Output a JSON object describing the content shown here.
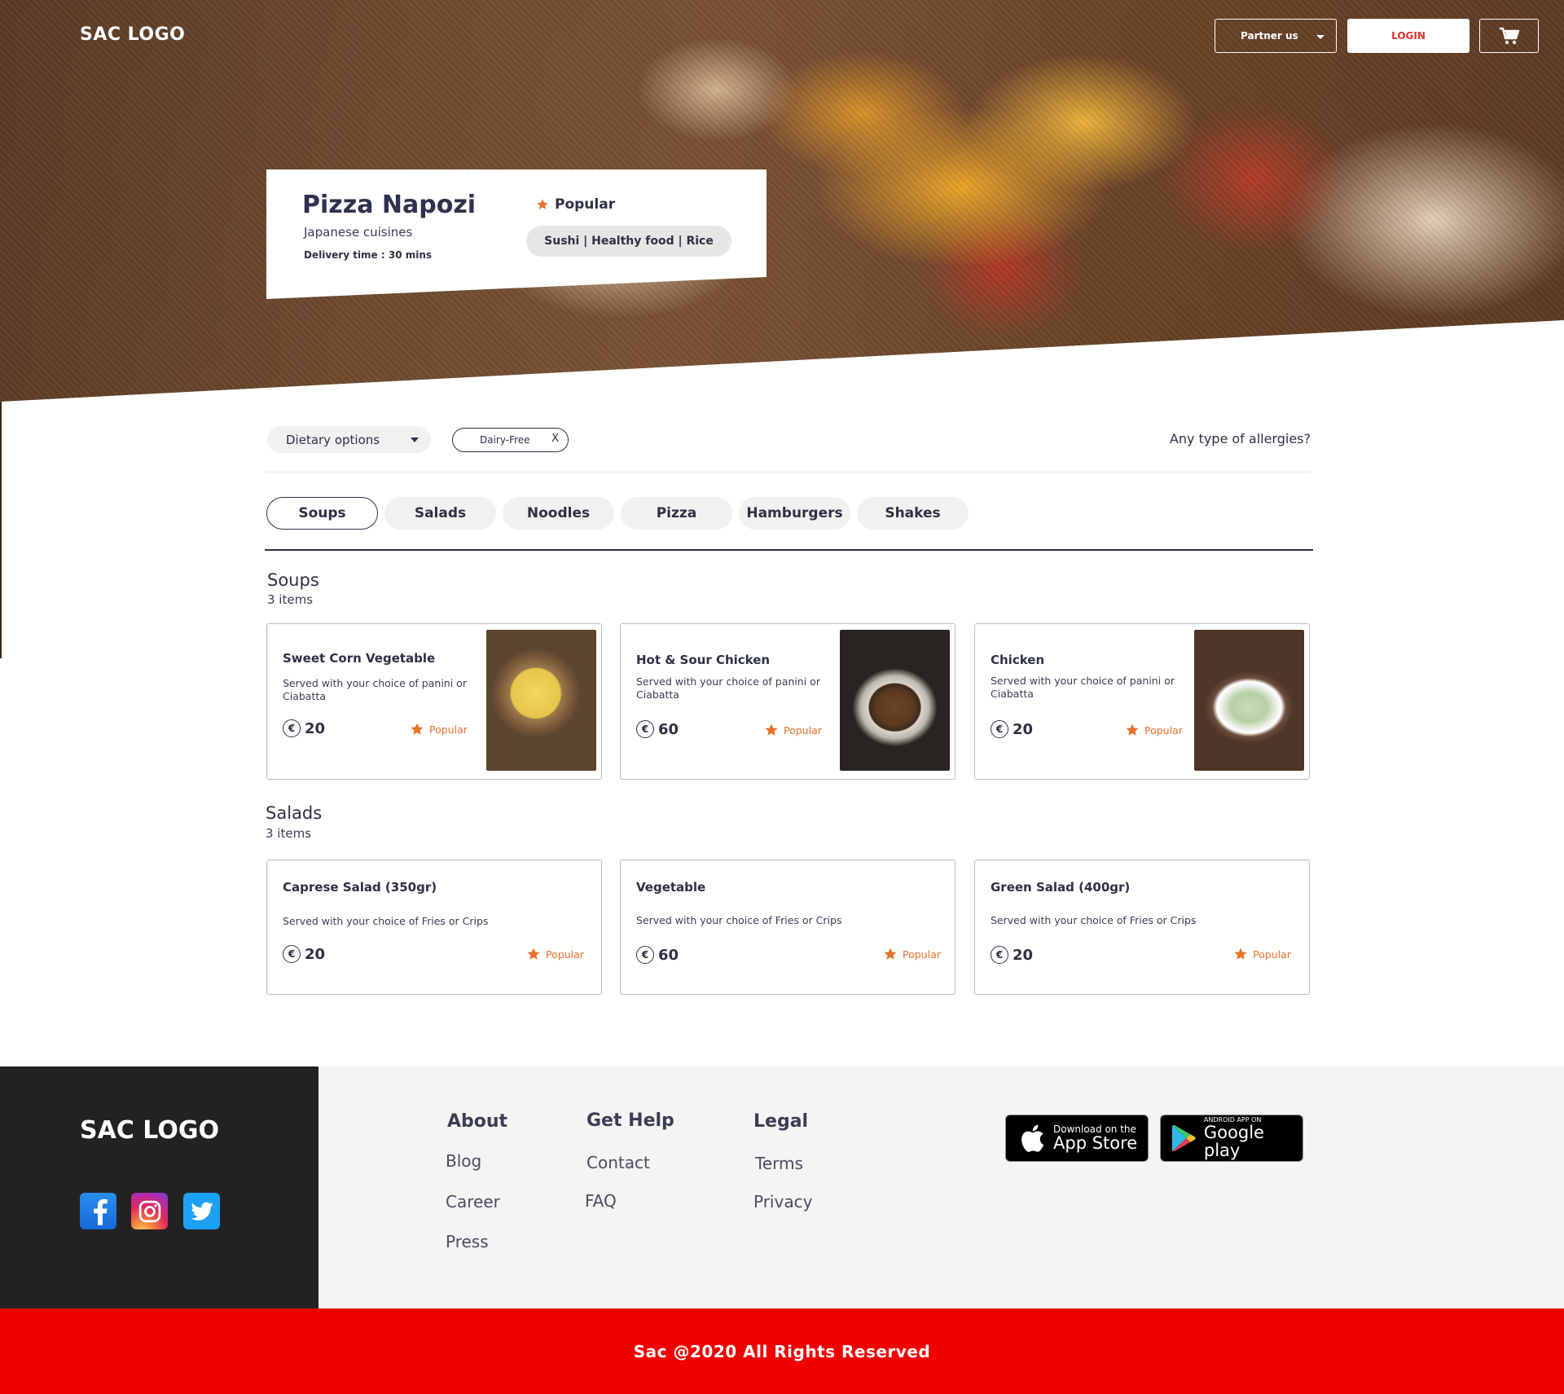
{
  "header": {
    "logo": "SAC LOGO",
    "partner_label": "Partner us",
    "login_label": "LOGIN"
  },
  "restaurant": {
    "name": "Pizza Napozi",
    "cuisine": "Japanese cuisines",
    "delivery": "Delivery time : 30 mins",
    "badge": "Popular",
    "tags": "Sushi | Healthy food | Rice"
  },
  "filters": {
    "dietary_label": "Dietary options",
    "chip_label": "Dairy-Free",
    "chip_close": "X",
    "allergies_label": "Any type of allergies?"
  },
  "tabs": [
    {
      "label": "Soups",
      "active": true
    },
    {
      "label": "Salads",
      "active": false
    },
    {
      "label": "Noodles",
      "active": false
    },
    {
      "label": "Pizza",
      "active": false
    },
    {
      "label": "Hamburgers",
      "active": false
    },
    {
      "label": "Shakes",
      "active": false
    }
  ],
  "sections": [
    {
      "title": "Soups",
      "count": "3 items",
      "items": [
        {
          "name": "Sweet Corn Vegetable",
          "desc": "Served with your choice of panini or Ciabatta",
          "price": "20",
          "badge": "Popular",
          "image": "corn-soup"
        },
        {
          "name": "Hot & Sour Chicken",
          "desc": "Served with your choice of panini or Ciabatta",
          "price": "60",
          "badge": "Popular",
          "image": "hot-sour-soup"
        },
        {
          "name": "Chicken",
          "desc": "Served with your choice of panini or Ciabatta",
          "price": "20",
          "badge": "Popular",
          "image": "chicken-soup"
        }
      ]
    },
    {
      "title": "Salads",
      "count": "3 items",
      "items": [
        {
          "name": "Caprese Salad (350gr)",
          "desc": "Served with your choice of Fries or Crips",
          "price": "20",
          "badge": "Popular"
        },
        {
          "name": "Vegetable",
          "desc": "Served with your choice of Fries or Crips",
          "price": "60",
          "badge": "Popular"
        },
        {
          "name": "Green Salad (400gr)",
          "desc": "Served with your choice of Fries or Crips",
          "price": "20",
          "badge": "Popular"
        }
      ]
    }
  ],
  "currency_symbol": "€",
  "footer": {
    "logo": "SAC LOGO",
    "columns": [
      {
        "title": "About",
        "links": [
          "Blog",
          "Career",
          "Press"
        ]
      },
      {
        "title": "Get Help",
        "links": [
          "Contact",
          "FAQ"
        ]
      },
      {
        "title": "Legal",
        "links": [
          "Terms",
          "Privacy"
        ]
      }
    ],
    "app_store": {
      "small": "Download on the",
      "big": "App Store"
    },
    "google_play": {
      "small": "ANDROID APP ON",
      "big": "Google play"
    },
    "copyright": "Sac @2020 All Rights Reserved"
  },
  "colors": {
    "accent": "#e0322c",
    "popular": "#e8702a",
    "bottom_bar": "#f20000",
    "text": "#2e3045"
  }
}
